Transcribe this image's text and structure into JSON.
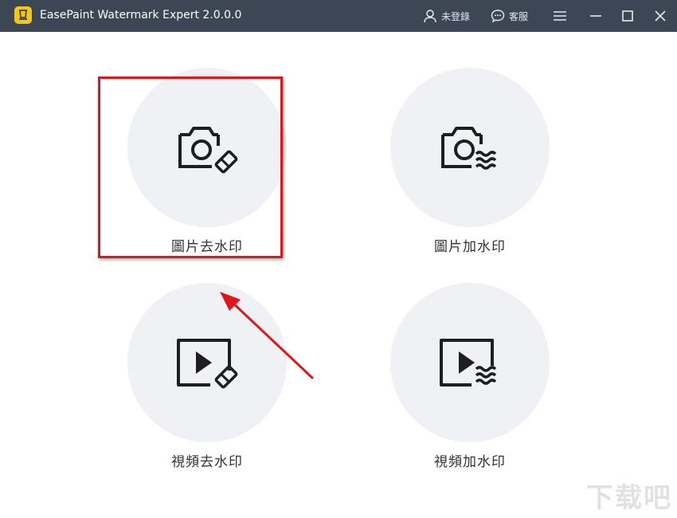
{
  "titlebar": {
    "title": "EasePaint Watermark Expert  2.0.0.0",
    "login_label": "未登錄",
    "support_label": "客服",
    "background": "#3c4654",
    "logo_color": "#f5c518"
  },
  "features": [
    {
      "label": "圖片去水印",
      "icon": "camera-eraser-icon"
    },
    {
      "label": "圖片加水印",
      "icon": "camera-waves-icon"
    },
    {
      "label": "視頻去水印",
      "icon": "video-eraser-icon"
    },
    {
      "label": "視頻加水印",
      "icon": "video-waves-icon"
    }
  ],
  "annotation": {
    "highlight_color": "#e0161b"
  },
  "watermark": {
    "text": "下载吧"
  }
}
